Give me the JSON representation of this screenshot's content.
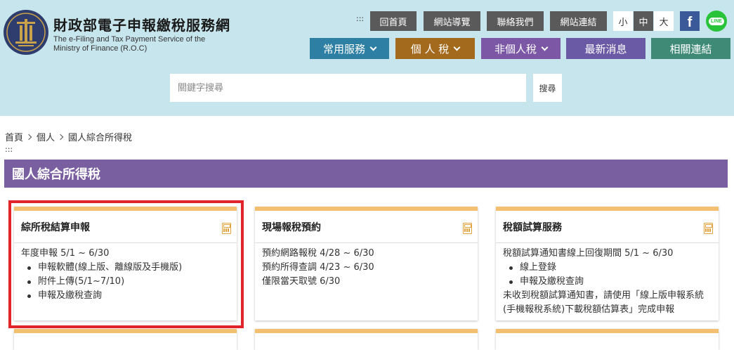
{
  "header": {
    "title": "財政部電子申報繳稅服務網",
    "subtitle_line1": "The e-Filing and Tax Payment Service of the",
    "subtitle_line2": "Ministry of Finance (R.O.C)",
    "access_key": ":::",
    "top_links": [
      "回首頁",
      "網站導覽",
      "聯絡我們",
      "網站連結"
    ],
    "font_sizes": [
      "小",
      "中",
      "大"
    ],
    "facebook_label": "f",
    "line_label": "LINE"
  },
  "nav": {
    "items": [
      {
        "label": "常用服務",
        "color": "#2d7fa3"
      },
      {
        "label": "個 人 稅",
        "color": "#a36a1e"
      },
      {
        "label": "非個人稅",
        "color": "#7b57a6"
      },
      {
        "label": "最新消息",
        "color": "#6a5aa6"
      },
      {
        "label": "相關連結",
        "color": "#3e8a76"
      }
    ]
  },
  "search": {
    "placeholder": "關鍵字搜尋",
    "button_label": "搜尋"
  },
  "breadcrumb": {
    "items": [
      "首頁",
      "個人",
      "國人綜合所得稅"
    ],
    "access_key": ":::"
  },
  "page": {
    "title": "國人綜合所得稅",
    "title_bar_color": "#7a5fa0"
  },
  "cards": [
    {
      "title": "綜所稅結算申報",
      "lines": [
        "年度申報 5/1 ~ 6/30"
      ],
      "bullets": [
        "申報軟體(線上版、離線版及手機版)",
        "附件上傳(5/1~7/10)",
        "申報及繳稅查詢"
      ]
    },
    {
      "title": "現場報稅預約",
      "lines": [
        "預約網路報稅 4/28 ~ 6/30",
        "預約所得查調 4/23 ~ 6/30",
        "僅限當天取號 6/30"
      ]
    },
    {
      "title": "稅額試算服務",
      "lines": [
        "稅額試算通知書線上回復期間 5/1 ~ 6/30"
      ],
      "bullets": [
        "線上登錄",
        "申報及繳稅查詢"
      ],
      "note_line1": "未收到稅額試算通知書，請使用「線上版申報系統",
      "note_line2": "(手機報稅系統)下載稅額估算表」完成申報"
    }
  ],
  "colors": {
    "header_bg": "#c7e5ec",
    "card_accent": "#f2c070",
    "highlight_border": "#e0242a"
  }
}
